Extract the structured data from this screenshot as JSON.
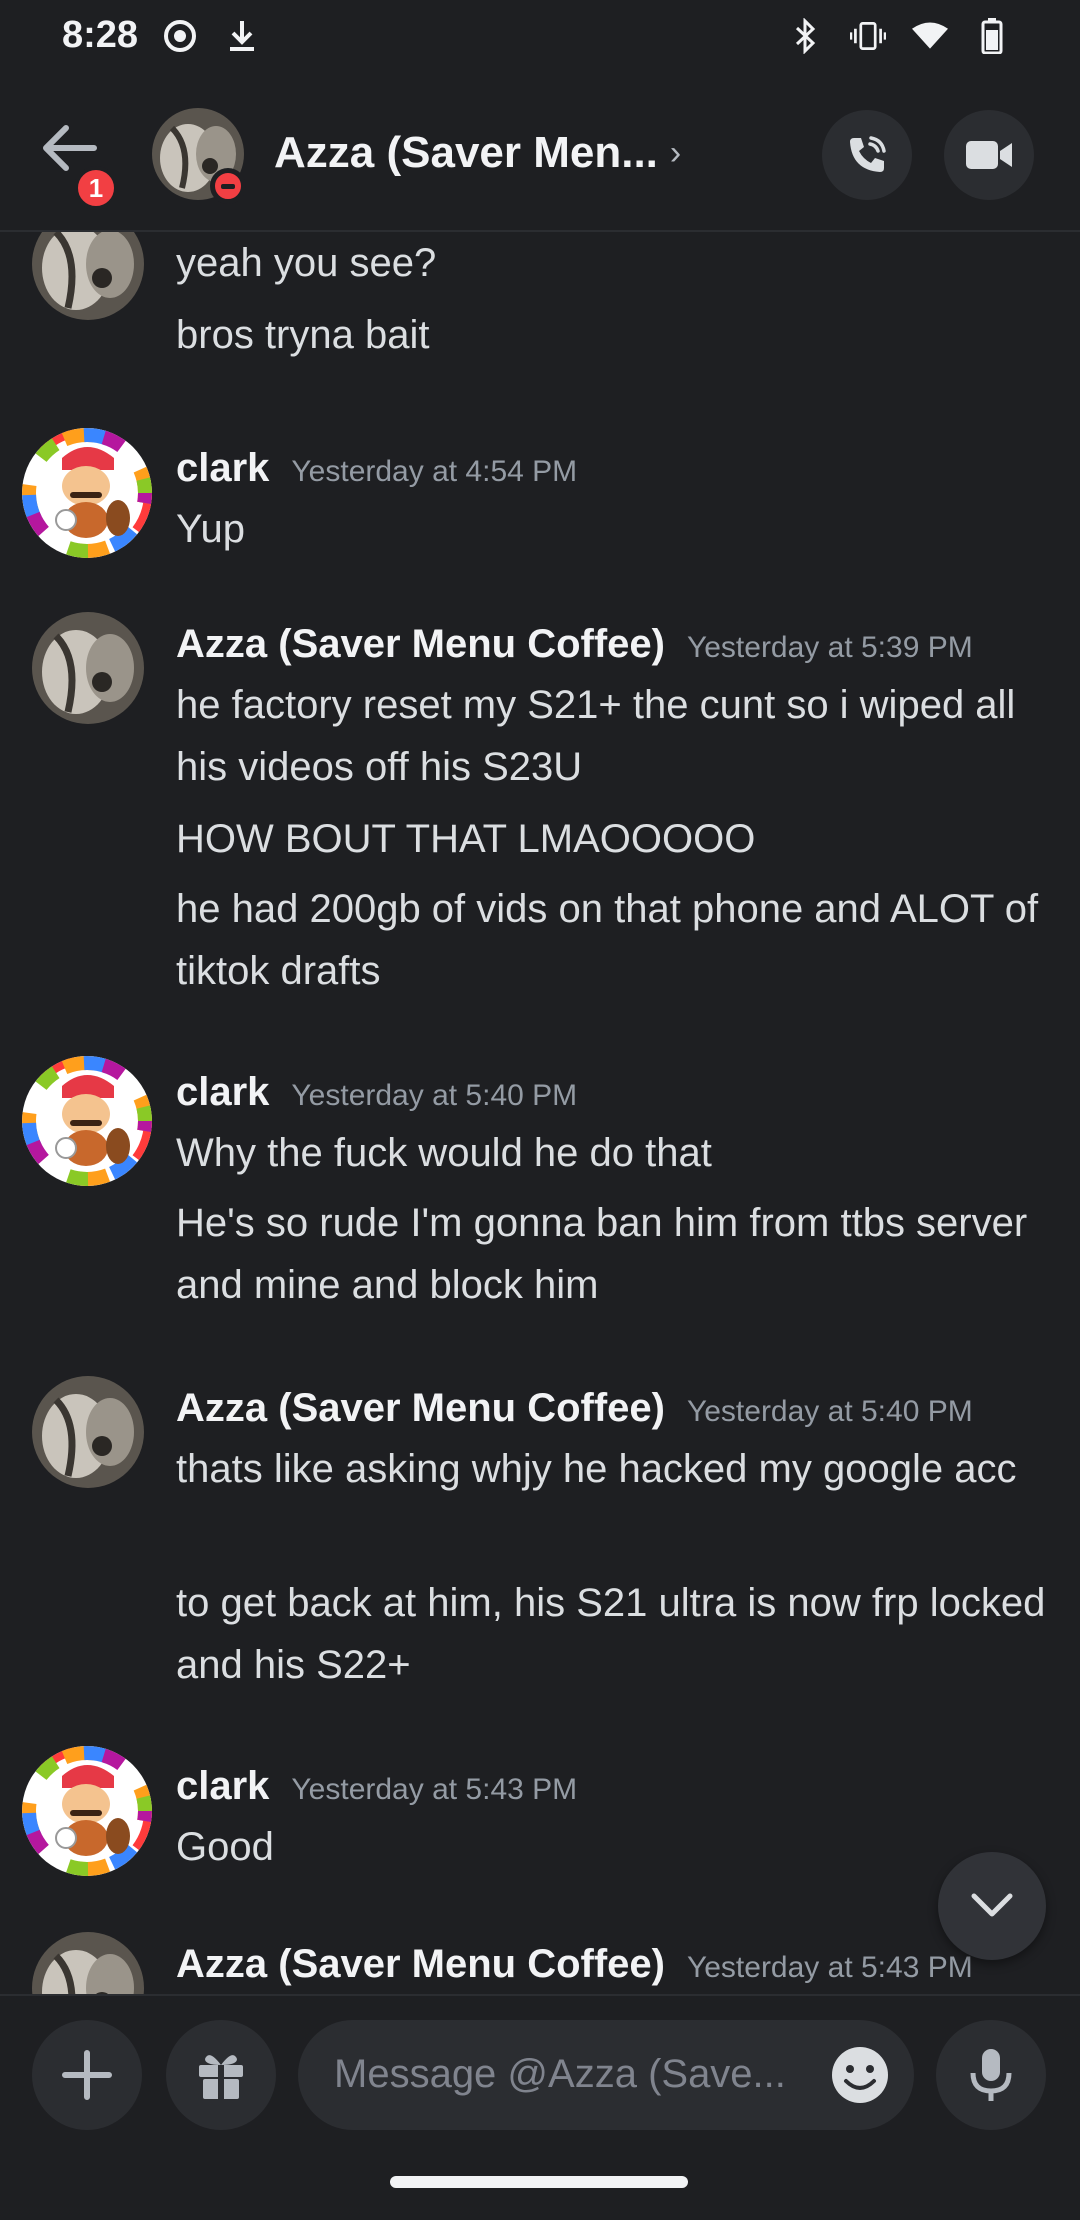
{
  "status_bar": {
    "time": "8:28",
    "icons_left": [
      "record-icon",
      "download-icon"
    ],
    "icons_right": [
      "bluetooth-icon",
      "vibrate-icon",
      "wifi-icon",
      "battery-icon"
    ]
  },
  "header": {
    "back_badge": "1",
    "title": "Azza (Saver Men...",
    "chevron": "›",
    "status": "do-not-disturb",
    "actions": [
      "voice-call",
      "video-call"
    ]
  },
  "messages": [
    {
      "partial": true,
      "author": "",
      "timestamp": "",
      "lines": [
        "yeah you see?",
        "bros tryna bait"
      ]
    },
    {
      "author": "clark",
      "timestamp": "Yesterday at 4:54 PM",
      "lines": [
        "Yup"
      ]
    },
    {
      "author": "Azza (Saver Menu Coffee)",
      "timestamp": "Yesterday at 5:39 PM",
      "lines": [
        "he factory reset my S21+ the cunt so i wiped all his videos off his S23U",
        "HOW BOUT THAT LMAOOOOO",
        "he had 200gb of vids on that phone and ALOT of tiktok drafts"
      ]
    },
    {
      "author": "clark",
      "timestamp": "Yesterday at 5:40 PM",
      "lines": [
        "Why the fuck would he do that",
        "He's so rude I'm gonna ban him from ttbs server and mine and block him"
      ]
    },
    {
      "author": "Azza (Saver Menu Coffee)",
      "timestamp": "Yesterday at 5:40 PM",
      "lines": [
        "thats like asking whjy he hacked my google acc",
        "to get back at him, his S21 ultra is now frp locked and his S22+"
      ]
    },
    {
      "author": "clark",
      "timestamp": "Yesterday at 5:43 PM",
      "lines": [
        "Good"
      ]
    },
    {
      "author": "Azza (Saver Menu Coffee)",
      "timestamp": "Yesterday at 5:43 PM",
      "lines": []
    }
  ],
  "composer": {
    "placeholder": "Message @Azza (Save..."
  },
  "colors": {
    "background": "#1e1f22",
    "surface": "#2b2d31",
    "text": "#dbdee1",
    "muted": "#949ba4",
    "badge_red": "#f23f43"
  }
}
